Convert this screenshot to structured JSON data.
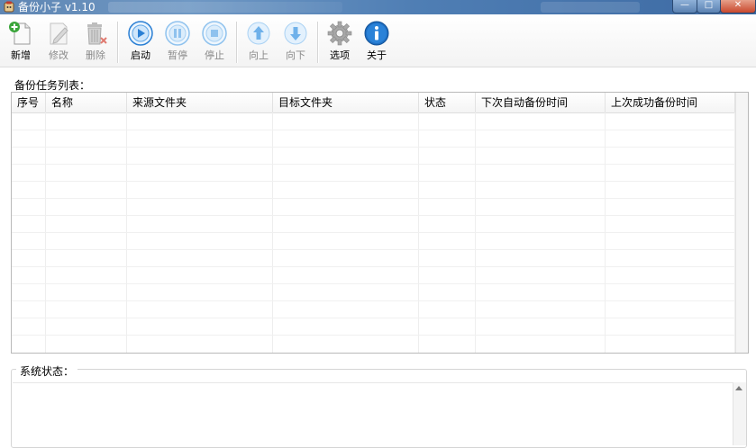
{
  "window": {
    "title": "备份小子 v1.10",
    "controls": {
      "minimize": "—",
      "maximize": "□",
      "close": "✕"
    }
  },
  "toolbar": {
    "buttons": [
      {
        "id": "add",
        "label": "新增",
        "icon": "add-document-icon",
        "enabled": true
      },
      {
        "id": "edit",
        "label": "修改",
        "icon": "edit-pencil-icon",
        "enabled": false
      },
      {
        "id": "delete",
        "label": "删除",
        "icon": "trash-icon",
        "enabled": false
      },
      {
        "id": "start",
        "label": "启动",
        "icon": "play-icon",
        "enabled": true
      },
      {
        "id": "pause",
        "label": "暂停",
        "icon": "pause-icon",
        "enabled": false
      },
      {
        "id": "stop",
        "label": "停止",
        "icon": "stop-icon",
        "enabled": false
      },
      {
        "id": "up",
        "label": "向上",
        "icon": "arrow-up-icon",
        "enabled": false
      },
      {
        "id": "down",
        "label": "向下",
        "icon": "arrow-down-icon",
        "enabled": false
      },
      {
        "id": "options",
        "label": "选项",
        "icon": "gear-icon",
        "enabled": true
      },
      {
        "id": "about",
        "label": "关于",
        "icon": "info-icon",
        "enabled": true
      }
    ]
  },
  "task_list": {
    "title": "备份任务列表：",
    "columns": [
      "序号",
      "名称",
      "来源文件夹",
      "目标文件夹",
      "状态",
      "下次自动备份时间",
      "上次成功备份时间"
    ],
    "rows": []
  },
  "system_status": {
    "title": "系统状态：",
    "text": ""
  },
  "colors": {
    "accent_blue": "#2a7fd4",
    "add_green": "#3aa53a",
    "delete_red": "#d9342b"
  }
}
